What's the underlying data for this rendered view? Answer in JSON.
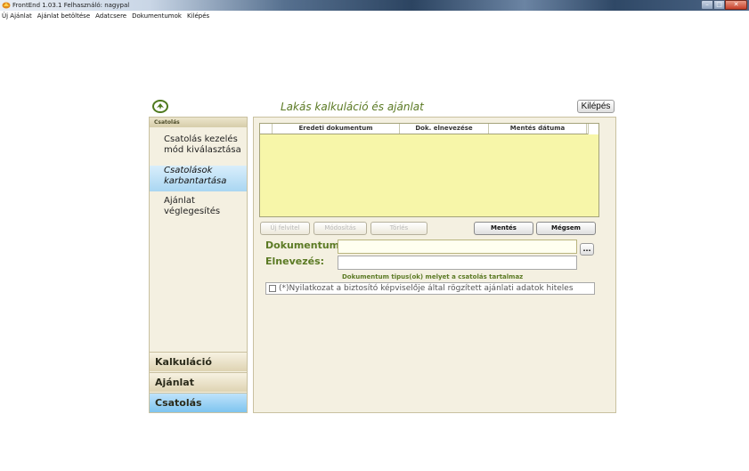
{
  "window": {
    "title": "FrontEnd 1.03.1  Felhasználó: nagypal",
    "min_label": "–",
    "max_label": "□",
    "close_label": "✕"
  },
  "menu": [
    "Új Ajánlat",
    "Ajánlat betöltése",
    "Adatcsere",
    "Dokumentumok",
    "Kilépés"
  ],
  "app": {
    "title": "Lakás kalkuláció és ajánlat",
    "exit_label": "Kilépés"
  },
  "sidebar": {
    "section_title": "Csatolás",
    "items": [
      {
        "label": "Csatolás kezelés mód kiválasztása",
        "selected": false
      },
      {
        "label": "Csatolások karbantartása",
        "selected": true
      },
      {
        "label": "Ajánlat véglegesítés",
        "selected": false
      }
    ],
    "tabs": [
      {
        "label": "Kalkuláció",
        "active": false
      },
      {
        "label": "Ajánlat",
        "active": false
      },
      {
        "label": "Csatolás",
        "active": true
      }
    ]
  },
  "grid": {
    "columns": [
      "Eredeti dokumentum",
      "Dok. elnevezése",
      "Mentés dátuma"
    ],
    "rows": []
  },
  "buttons": {
    "new": "Új felvitel",
    "modify": "Módosítás",
    "delete": "Törlés",
    "save": "Mentés",
    "cancel": "Mégsem"
  },
  "form": {
    "document_label": "Dokumentum:",
    "document_value": "",
    "name_label": "Elnevezés:",
    "name_value": "",
    "browse_label": "...",
    "doctype_label": "Dokumentum tipus(ok) melyet a csatolás tartalmaz",
    "doctype_items": [
      {
        "label": "(*)Nyilatkozat a biztosító képviselője által rögzített ajánlati adatok hiteles",
        "checked": false
      }
    ]
  },
  "colors": {
    "accent_green": "#5b7a24",
    "panel_bg": "#f4f0e1",
    "grid_bg": "#f7f6a9",
    "active_tab": "#7ec4ef"
  }
}
